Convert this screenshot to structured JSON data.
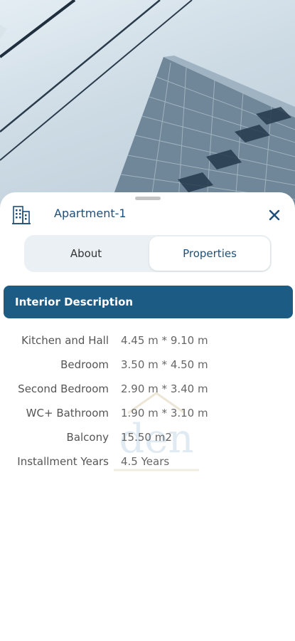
{
  "header": {
    "title": "Apartment-1"
  },
  "tabs": [
    {
      "label": "About",
      "active": false
    },
    {
      "label": "Properties",
      "active": true
    }
  ],
  "section": {
    "title": "Interior Description"
  },
  "properties": [
    {
      "label": "Kitchen and Hall",
      "value": "4.45 m * 9.10 m"
    },
    {
      "label": "Bedroom",
      "value": "3.50 m * 4.50 m"
    },
    {
      "label": "Second Bedroom",
      "value": "2.90 m * 3.40 m"
    },
    {
      "label": "WC+ Bathroom",
      "value": "1.90 m * 3.10 m"
    },
    {
      "label": "Balcony",
      "value": "15.50 m2"
    },
    {
      "label": "Installment Years",
      "value": "4.5 Years"
    }
  ],
  "watermark": {
    "text": "den"
  },
  "colors": {
    "primary": "#1b5b84",
    "title": "#1e4f7a",
    "tab_bg": "#eaf0f4"
  }
}
